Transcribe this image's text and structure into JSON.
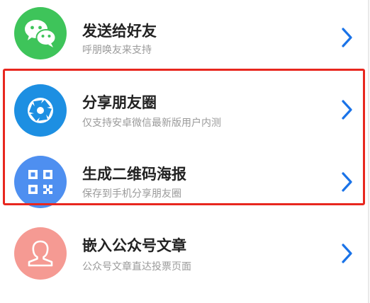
{
  "share_options": [
    {
      "title": "发送给好友",
      "subtitle": "呼朋唤友来支持",
      "icon": "wechat-icon",
      "icon_color": "#3ec45a"
    },
    {
      "title": "分享朋友圈",
      "subtitle": "仅支持安卓微信最新版用户内测",
      "icon": "moments-shutter-icon",
      "icon_color": "#1d8fe2"
    },
    {
      "title": "生成二维码海报",
      "subtitle": "保存到手机分享朋友圈",
      "icon": "qr-code-icon",
      "icon_color": "#4e8ff0"
    },
    {
      "title": "嵌入公众号文章",
      "subtitle": "公众号文章直达投票页面",
      "icon": "official-account-person-icon",
      "icon_color": "#f59a93"
    }
  ],
  "colors": {
    "chevron": "#1a73e8",
    "highlight_border": "#e8271f",
    "title_text": "#222222",
    "subtitle_text": "#9a9a9a"
  }
}
